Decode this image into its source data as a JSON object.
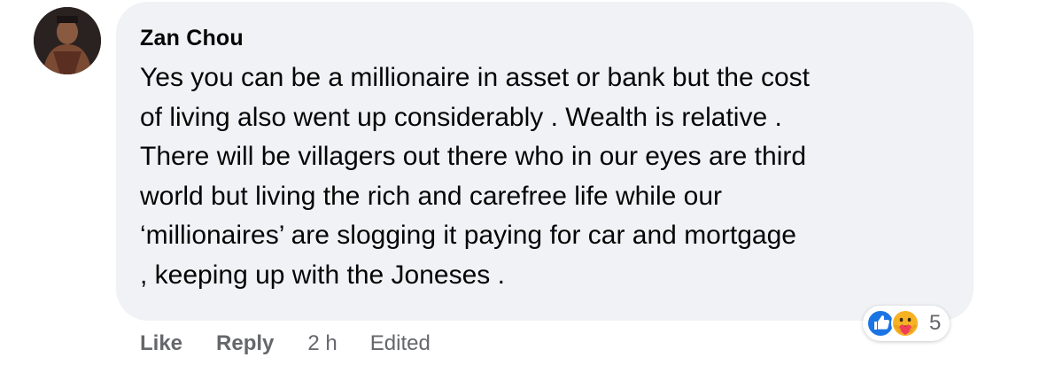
{
  "comment": {
    "author": "Zan Chou",
    "text": "Yes you can be a millionaire in asset or bank but the cost\nof living also went up considerably . Wealth is relative .\nThere will be villagers out there who in our eyes are third\nworld but living the rich and carefree life while our\n‘millionaires’ are slogging it paying for car and mortgage\n, keeping up with the Joneses .",
    "actions": {
      "like": "Like",
      "reply": "Reply",
      "time": "2 h",
      "edited": "Edited"
    },
    "reactions": {
      "icons": [
        "like-icon",
        "care-icon"
      ],
      "count": "5"
    }
  },
  "colors": {
    "bubble": "#f0f2f5",
    "text": "#050505",
    "secondary": "#65676b",
    "like_blue": "#1b74e4",
    "care_yellow": "#f7b125",
    "care_red": "#f33e58"
  }
}
